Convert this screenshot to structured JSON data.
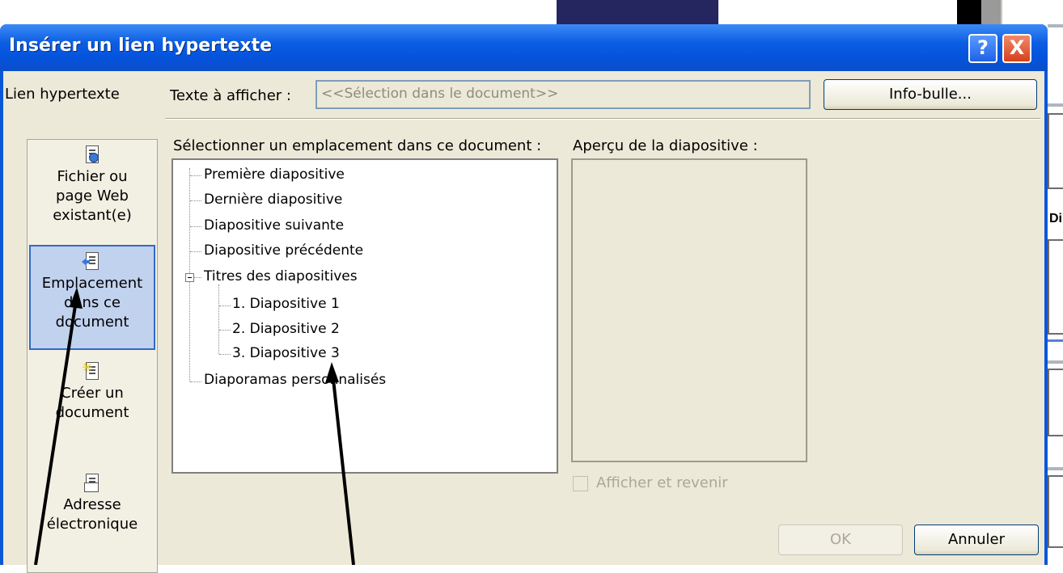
{
  "dialog": {
    "title": "Insérer un lien hypertexte",
    "help_button": "?",
    "close_button": "X",
    "link_to_label": "Lien hypertexte",
    "sidebar": [
      {
        "label1": "Fichier ou",
        "label2": "page Web",
        "label3": "existant(e)",
        "icon": "web-page-icon"
      },
      {
        "label1": "Emplacement",
        "label2": "dans ce",
        "label3": "document",
        "icon": "place-in-document-icon"
      },
      {
        "label1": "Créer un",
        "label2": "document",
        "icon": "new-document-icon"
      },
      {
        "label1": "Adresse",
        "label2": "électronique",
        "icon": "email-address-icon"
      }
    ],
    "text_to_display_label": "Texte à afficher :",
    "text_to_display_value": "<<Sélection dans le document>>",
    "screentip_button": "Info-bulle...",
    "select_place_label": "Sélectionner un emplacement dans ce document :",
    "slide_preview_label": "Aperçu de la diapositive :",
    "tree": {
      "first": "Première diapositive",
      "last": "Dernière diapositive",
      "next": "Diapositive suivante",
      "previous": "Diapositive précédente",
      "titles": "Titres des diapositives",
      "slide1": "1. Diapositive 1",
      "slide2": "2. Diapositive 2",
      "slide3": "3. Diapositive 3",
      "custom": "Diaporamas personnalisés"
    },
    "show_and_return_label": "Afficher et revenir",
    "ok_button": "OK",
    "cancel_button": "Annuler"
  },
  "background": {
    "fragment_text": "Di"
  }
}
